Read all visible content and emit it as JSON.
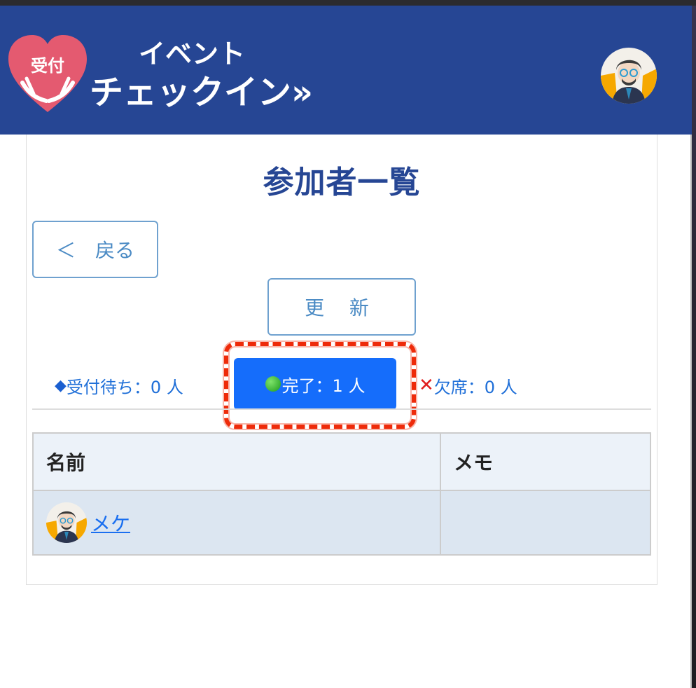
{
  "header": {
    "logo_badge": "受付",
    "logo_line1": "イベント",
    "logo_line2": "チェックイン»",
    "avatar_icon": "user-avatar-icon"
  },
  "page": {
    "title": "参加者一覧",
    "back_label": "＜　戻る",
    "refresh_label": "更 新"
  },
  "tabs": {
    "waiting_symbol": "◆",
    "waiting_label": "受付待ち：0 人",
    "done_symbol": "●",
    "done_label": "完了：1 人",
    "absent_symbol": "✕",
    "absent_label": "欠席：0 人"
  },
  "table": {
    "columns": [
      "名前",
      "メモ"
    ],
    "rows": [
      {
        "name": " メケ",
        "memo": ""
      }
    ]
  },
  "colors": {
    "header_bg": "#264694",
    "accent_blue": "#156dfb",
    "highlight_red": "#ee2b0a"
  }
}
